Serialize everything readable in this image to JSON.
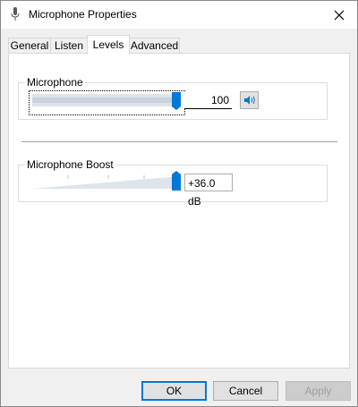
{
  "window": {
    "title": "Microphone Properties"
  },
  "tabs": [
    {
      "label": "General",
      "active": false
    },
    {
      "label": "Listen",
      "active": false
    },
    {
      "label": "Levels",
      "active": true
    },
    {
      "label": "Advanced",
      "active": false
    }
  ],
  "microphone": {
    "label": "Microphone",
    "value": "100",
    "level": 1.0,
    "mute_icon": "speaker-icon"
  },
  "boost": {
    "label": "Microphone Boost",
    "value": "+36.0 dB",
    "level": 1.0
  },
  "buttons": {
    "ok": "OK",
    "cancel": "Cancel",
    "apply": "Apply"
  },
  "colors": {
    "accent": "#0078d7",
    "track": "#dde4ec"
  }
}
